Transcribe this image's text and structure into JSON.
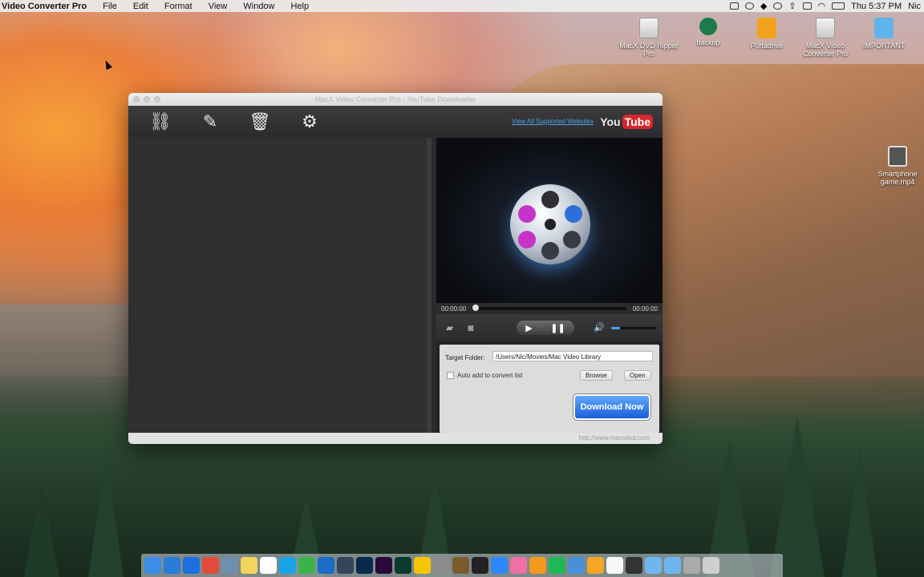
{
  "menubar": {
    "app_name": "Video Converter Pro",
    "items": [
      "File",
      "Edit",
      "Format",
      "View",
      "Window",
      "Help"
    ],
    "clock": "Thu 5:37 PM",
    "user": "Nic"
  },
  "desktop": {
    "icons": [
      {
        "label": "MacX DVD Ripper Pro",
        "icon": "drive-icon"
      },
      {
        "label": "backup",
        "icon": "time-machine-icon"
      },
      {
        "label": "P0rtadrive",
        "icon": "external-drive-icon"
      },
      {
        "label": "MacX Video Converter Pro",
        "icon": "drive-icon"
      },
      {
        "label": "IMPORTANT",
        "icon": "folder-icon"
      },
      {
        "label": "Smartphone game.mp4",
        "icon": "video-file-icon"
      }
    ]
  },
  "window": {
    "title": "MacX Video Converter Pro - YouTube Downloader",
    "toolbar": {
      "add_url_icon": "link-icon",
      "clean_icon": "brush-icon",
      "delete_icon": "trash-icon",
      "settings_icon": "gear-icon",
      "supported_link": "View All Supported Websites",
      "youtube_you": "You",
      "youtube_tube": "Tube"
    },
    "player": {
      "time_start": "00:00:00",
      "time_end": "00:00:00",
      "progress": 0,
      "volume": 0.2
    },
    "settings": {
      "target_folder_label": "Target Folder:",
      "target_folder_value": "/Users/Nic/Movies/Mac Video Library",
      "auto_add_label": "Auto add to convert list",
      "auto_add_checked": false,
      "browse_label": "Browse",
      "open_label": "Open",
      "download_label": "Download Now"
    },
    "footer_url": "http://www.macxdvd.com"
  },
  "dock": {
    "apps": [
      "Finder",
      "App Store",
      "Safari",
      "Chrome",
      "Preview",
      "Notes",
      "Calendar",
      "Skype",
      "Evernote",
      "Outlook",
      "Tumblr",
      "Photoshop",
      "Premiere",
      "Audition",
      "Vectr",
      "Script Editor",
      "Claquette",
      "Final Cut",
      "Messenger",
      "iTunes",
      "iBooks",
      "Spotify",
      "QuickTime",
      "Photos",
      "Pages",
      "Video Converter",
      "Folder",
      "Downloads",
      "Disk Utility",
      "Trash"
    ]
  }
}
